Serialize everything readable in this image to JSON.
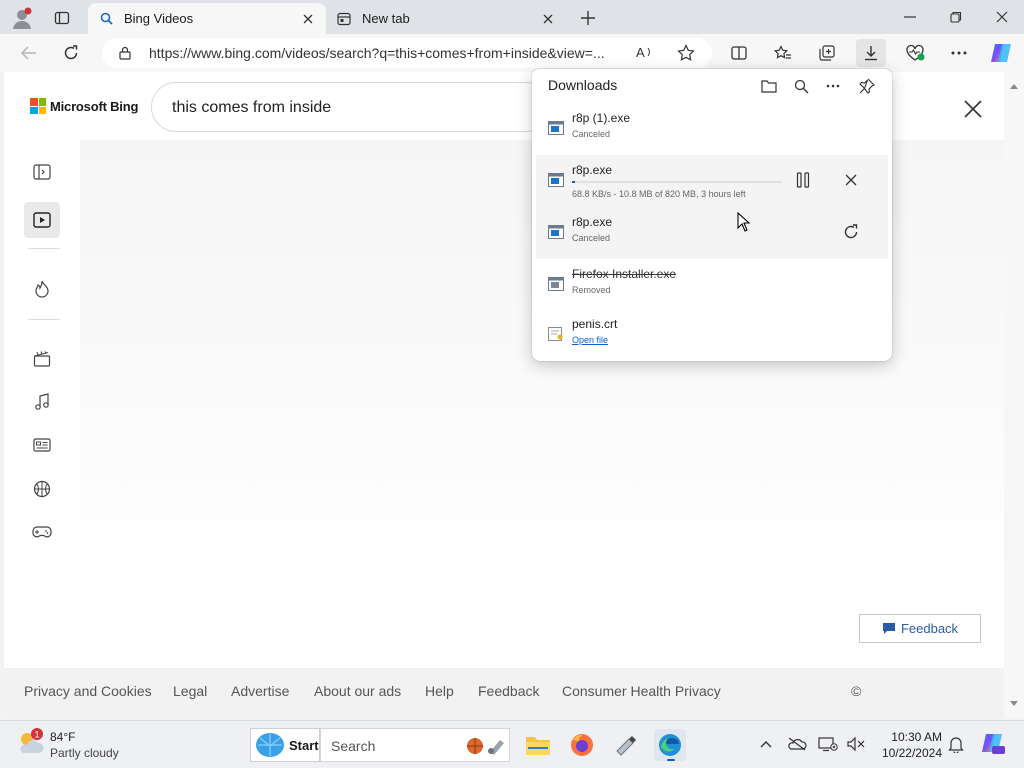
{
  "browser": {
    "tabs": [
      {
        "label": "Bing Videos",
        "active": true
      },
      {
        "label": "New tab",
        "active": false
      }
    ],
    "address": "https://www.bing.com/videos/search?q=this+comes+from+inside&view=..."
  },
  "page": {
    "logo_text": "Microsoft Bing",
    "search_query": "this comes from inside",
    "footer_links": [
      "Privacy and Cookies",
      "Legal",
      "Advertise",
      "About our ads",
      "Help",
      "Feedback",
      "Consumer Health Privacy"
    ],
    "copyright_fragment": "©",
    "feedback_button": "Feedback"
  },
  "downloads": {
    "title": "Downloads",
    "items": [
      {
        "name": "r8p (1).exe",
        "status": "Canceled",
        "type": "exe"
      },
      {
        "name": "r8p.exe",
        "status": "68.8 KB/s - 10.8 MB of 820 MB, 3 hours left",
        "type": "exe",
        "progress": 0.013
      },
      {
        "name": "r8p.exe",
        "status": "Canceled",
        "type": "exe"
      },
      {
        "name": "Firefox Installer.exe",
        "status": "Removed",
        "type": "exe-removed"
      },
      {
        "name": "penis.crt",
        "status": "Open file",
        "type": "crt"
      }
    ]
  },
  "taskbar": {
    "weather_temp": "84°F",
    "weather_condition": "Partly cloudy",
    "weather_badge": "1",
    "start_label": "Start",
    "search_label": "Search",
    "time": "10:30 AM",
    "date": "10/22/2024"
  },
  "colors": {
    "accent": "#0a5fd6",
    "download_flyout_bg": "#ffffff"
  }
}
